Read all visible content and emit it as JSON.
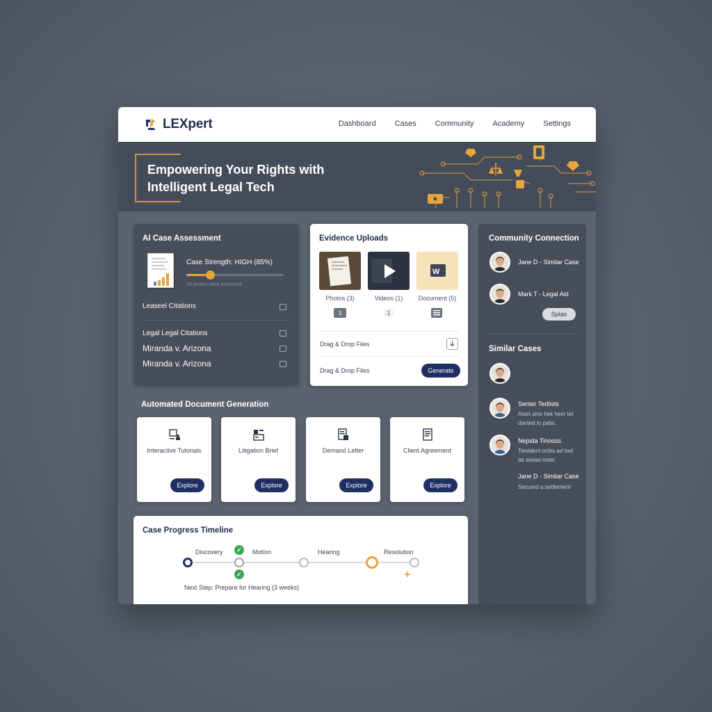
{
  "app": {
    "name": "LEXpert",
    "nav": [
      "Dashboard",
      "Cases",
      "Community",
      "Academy",
      "Settings"
    ]
  },
  "hero": {
    "line1": "Empowering Your Rights with",
    "line2": "Intelligent Legal Tech"
  },
  "assessment": {
    "title": "AI Case Assessment",
    "strength_label": "Case Strength: HIGH (85%)",
    "strength_value": 0.2,
    "caption": "15 factors were assessed",
    "citations_header": "Leaseel Citations",
    "rows": [
      "Legal Legal Citations",
      "Miranda v. Arizona",
      "Miranda v. Arizona"
    ]
  },
  "evidence": {
    "title": "Evidence Uploads",
    "items": [
      {
        "label": "Photos (3)",
        "badge": "3"
      },
      {
        "label": "Videos (1)",
        "badge": "1"
      },
      {
        "label": "Document (5)",
        "badge": ""
      }
    ],
    "doc_glyph": "W",
    "drag1": "Drag & Drop Files",
    "drag2": "Drag & Drop Files",
    "generate": "Generate"
  },
  "community": {
    "title": "Community Connection",
    "people": [
      {
        "name": "Jane D - Similar Case"
      },
      {
        "name": "Mark T - Legal Aid"
      }
    ],
    "pill": "Splas",
    "similar_title": "Similar Cases",
    "similar": [
      {
        "name": "Jane D - Similar Case",
        "sub1": "Secured a settlement",
        "sub2": ""
      },
      {
        "name": "Senter Tedlists",
        "sub1": "Aiset alne hek heer tet",
        "sub2": "danted to pabs."
      },
      {
        "name": "Nepida Tinooss",
        "sub1": "Tievident ocbis ad tisd",
        "sub2": "tat snead inset."
      }
    ]
  },
  "docgen": {
    "title": "Automated Document Generation",
    "cards": [
      {
        "label": "Interactive Tutorials",
        "button": "Explore"
      },
      {
        "label": "Litigation Brief",
        "button": "Explore"
      },
      {
        "label": "Demand Letter",
        "button": "Explore"
      },
      {
        "label": "Client Agreement",
        "button": "Explore"
      }
    ]
  },
  "timeline": {
    "title": "Case Progress Timeline",
    "stages": [
      "Discovery",
      "Motion",
      "Hearing",
      "Resolution"
    ],
    "next_step": "Next Step: Prepare for Hearing (3 weeks)"
  },
  "colors": {
    "navy": "#1f2f63",
    "gold": "#e7a33c",
    "green": "#3aa655"
  }
}
